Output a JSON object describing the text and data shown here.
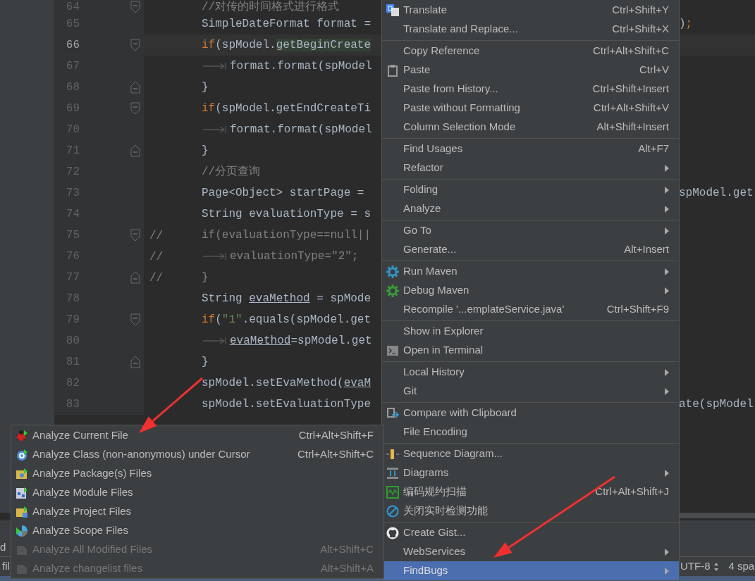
{
  "editor": {
    "lines": [
      {
        "number": "64",
        "current": false,
        "fold": {
          "kind": "start"
        },
        "segments": [
          {
            "text": "//对传的时间格式进行格式",
            "kind": "comment"
          }
        ]
      },
      {
        "number": "65",
        "current": false,
        "segments": [
          {
            "text": "SimpleDateFormat format = ",
            "kind": "plain"
          }
        ],
        "tail": [
          {
            "text": ")",
            "kind": "plain"
          },
          {
            "text": ";",
            "kind": "keyword"
          }
        ]
      },
      {
        "number": "66",
        "current": true,
        "fold": {
          "kind": "start"
        },
        "segments": [
          {
            "text": "if",
            "kind": "keyword"
          },
          {
            "text": "(spModel.",
            "kind": "plain"
          },
          {
            "text": "getBeginCreate",
            "kind": "highlight"
          }
        ]
      },
      {
        "number": "67",
        "current": false,
        "inner": true,
        "segments": [
          {
            "text": "format.format(spModel",
            "kind": "plain"
          }
        ]
      },
      {
        "number": "68",
        "current": false,
        "fold": {
          "kind": "end"
        },
        "segments": [
          {
            "text": "}",
            "kind": "plain"
          }
        ]
      },
      {
        "number": "69",
        "current": false,
        "fold": {
          "kind": "start"
        },
        "segments": [
          {
            "text": "if",
            "kind": "keyword"
          },
          {
            "text": "(spModel.getEndCreateTi",
            "kind": "plain"
          }
        ]
      },
      {
        "number": "70",
        "current": false,
        "inner": true,
        "segments": [
          {
            "text": "format.format(spModel",
            "kind": "plain"
          }
        ]
      },
      {
        "number": "71",
        "current": false,
        "fold": {
          "kind": "end"
        },
        "segments": [
          {
            "text": "}",
            "kind": "plain"
          }
        ]
      },
      {
        "number": "72",
        "current": false,
        "segments": [
          {
            "text": "//分页查询",
            "kind": "comment"
          }
        ]
      },
      {
        "number": "73",
        "current": false,
        "segments": [
          {
            "text": "Page<Object> startPage = ",
            "kind": "plain"
          }
        ],
        "tail": [
          {
            "text": "spModel.get",
            "kind": "plain"
          }
        ]
      },
      {
        "number": "74",
        "current": false,
        "segments": [
          {
            "text": "String evaluationType = s",
            "kind": "plain"
          }
        ]
      },
      {
        "number": "75",
        "current": false,
        "fold": {
          "kind": "start"
        },
        "prefix": "//",
        "segments": [
          {
            "text": "if(evaluationType==null||",
            "kind": "comment"
          }
        ]
      },
      {
        "number": "76",
        "current": false,
        "inner": true,
        "prefix": "//",
        "segments": [
          {
            "text": "evaluationType=\"2\";",
            "kind": "comment"
          }
        ]
      },
      {
        "number": "77",
        "current": false,
        "fold": {
          "kind": "end"
        },
        "prefix": "//",
        "segments": [
          {
            "text": "}",
            "kind": "comment"
          }
        ]
      },
      {
        "number": "78",
        "current": false,
        "segments": [
          {
            "text": "String ",
            "kind": "plain"
          },
          {
            "text": "evaMethod",
            "kind": "underline"
          },
          {
            "text": " = spMode",
            "kind": "plain"
          }
        ]
      },
      {
        "number": "79",
        "current": false,
        "fold": {
          "kind": "start"
        },
        "segments": [
          {
            "text": "if",
            "kind": "keyword"
          },
          {
            "text": "(",
            "kind": "plain"
          },
          {
            "text": "\"1\"",
            "kind": "string"
          },
          {
            "text": ".equals(spModel.get",
            "kind": "plain"
          }
        ]
      },
      {
        "number": "80",
        "current": false,
        "inner": true,
        "segments": [
          {
            "text": "evaMethod",
            "kind": "underline"
          },
          {
            "text": "=spModel.get",
            "kind": "plain"
          }
        ]
      },
      {
        "number": "81",
        "current": false,
        "fold": {
          "kind": "end"
        },
        "segments": [
          {
            "text": "}",
            "kind": "plain"
          }
        ]
      },
      {
        "number": "82",
        "current": false,
        "segments": [
          {
            "text": "spModel.setEvaMethod(",
            "kind": "plain"
          },
          {
            "text": "evaM",
            "kind": "underline"
          }
        ]
      },
      {
        "number": "83",
        "current": false,
        "segments": [
          {
            "text": "spModel.setEvaluationType",
            "kind": "plain"
          }
        ],
        "tail": [
          {
            "text": "ate(spModel",
            "kind": "plain"
          }
        ]
      }
    ]
  },
  "context_menu": {
    "sections": [
      [
        {
          "label": "Translate",
          "shortcut": "Ctrl+Shift+Y",
          "submenu": false,
          "selected": false
        },
        {
          "label": "Translate and Replace...",
          "shortcut": "Ctrl+Shift+X",
          "submenu": false,
          "selected": false
        }
      ],
      [
        {
          "label": "Copy Reference",
          "shortcut": "Ctrl+Alt+Shift+C",
          "submenu": false,
          "selected": false
        },
        {
          "label": "Paste",
          "shortcut": "Ctrl+V",
          "submenu": false,
          "selected": false
        },
        {
          "label": "Paste from History...",
          "shortcut": "Ctrl+Shift+Insert",
          "submenu": false,
          "selected": false
        },
        {
          "label": "Paste without Formatting",
          "shortcut": "Ctrl+Alt+Shift+V",
          "submenu": false,
          "selected": false
        },
        {
          "label": "Column Selection Mode",
          "shortcut": "Alt+Shift+Insert",
          "submenu": false,
          "selected": false
        }
      ],
      [
        {
          "label": "Find Usages",
          "shortcut": "Alt+F7",
          "submenu": false,
          "selected": false
        },
        {
          "label": "Refactor",
          "submenu": true,
          "selected": false
        }
      ],
      [
        {
          "label": "Folding",
          "submenu": true,
          "selected": false
        },
        {
          "label": "Analyze",
          "submenu": true,
          "selected": false
        }
      ],
      [
        {
          "label": "Go To",
          "submenu": true,
          "selected": false
        },
        {
          "label": "Generate...",
          "shortcut": "Alt+Insert",
          "submenu": false,
          "selected": false
        }
      ],
      [
        {
          "label": "Run Maven",
          "submenu": true,
          "selected": false
        },
        {
          "label": "Debug Maven",
          "submenu": true,
          "selected": false
        },
        {
          "label": "Recompile '...emplateService.java'",
          "shortcut": "Ctrl+Shift+F9",
          "submenu": false,
          "selected": false
        }
      ],
      [
        {
          "label": "Show in Explorer",
          "submenu": false,
          "selected": false
        },
        {
          "label": "Open in Terminal",
          "submenu": false,
          "selected": false
        }
      ],
      [
        {
          "label": "Local History",
          "submenu": true,
          "selected": false
        },
        {
          "label": "Git",
          "submenu": true,
          "selected": false
        }
      ],
      [
        {
          "label": "Compare with Clipboard",
          "submenu": false,
          "selected": false
        },
        {
          "label": "File Encoding",
          "submenu": false,
          "selected": false
        }
      ],
      [
        {
          "label": "Sequence Diagram...",
          "submenu": false,
          "selected": false
        },
        {
          "label": "Diagrams",
          "submenu": true,
          "selected": false
        },
        {
          "label": "编码规约扫描",
          "shortcut": "Ctrl+Alt+Shift+J",
          "submenu": false,
          "selected": false
        },
        {
          "label": "关闭实时检测功能",
          "submenu": false,
          "selected": false
        }
      ],
      [
        {
          "label": "Create Gist...",
          "submenu": false,
          "selected": false
        },
        {
          "label": "WebServices",
          "submenu": true,
          "selected": false
        },
        {
          "label": "FindBugs",
          "submenu": true,
          "selected": true
        }
      ]
    ]
  },
  "findbugs_submenu": {
    "items": [
      {
        "label": "Analyze Current File",
        "shortcut": "Ctrl+Alt+Shift+F",
        "disabled": false
      },
      {
        "label": "Analyze Class (non-anonymous) under Cursor",
        "shortcut": "Ctrl+Alt+Shift+C",
        "disabled": false
      },
      {
        "label": "Analyze Package(s) Files",
        "disabled": false
      },
      {
        "label": "Analyze Module Files",
        "disabled": false
      },
      {
        "label": "Analyze Project Files",
        "disabled": false
      },
      {
        "label": "Analyze Scope Files",
        "disabled": false
      },
      {
        "label": "Analyze All Modified Files",
        "shortcut": "Alt+Shift+C",
        "disabled": true
      },
      {
        "label": "Analyze changelist files",
        "shortcut": "Alt+Shift+A",
        "disabled": true
      }
    ]
  },
  "bottom_panel": {
    "texts": [
      "d",
      "fil"
    ]
  },
  "status_bar": {
    "encoding": "UTF-8",
    "indent": "4 spa"
  },
  "annotations": [
    {
      "kind": "arrow"
    },
    {
      "kind": "arrow"
    }
  ]
}
